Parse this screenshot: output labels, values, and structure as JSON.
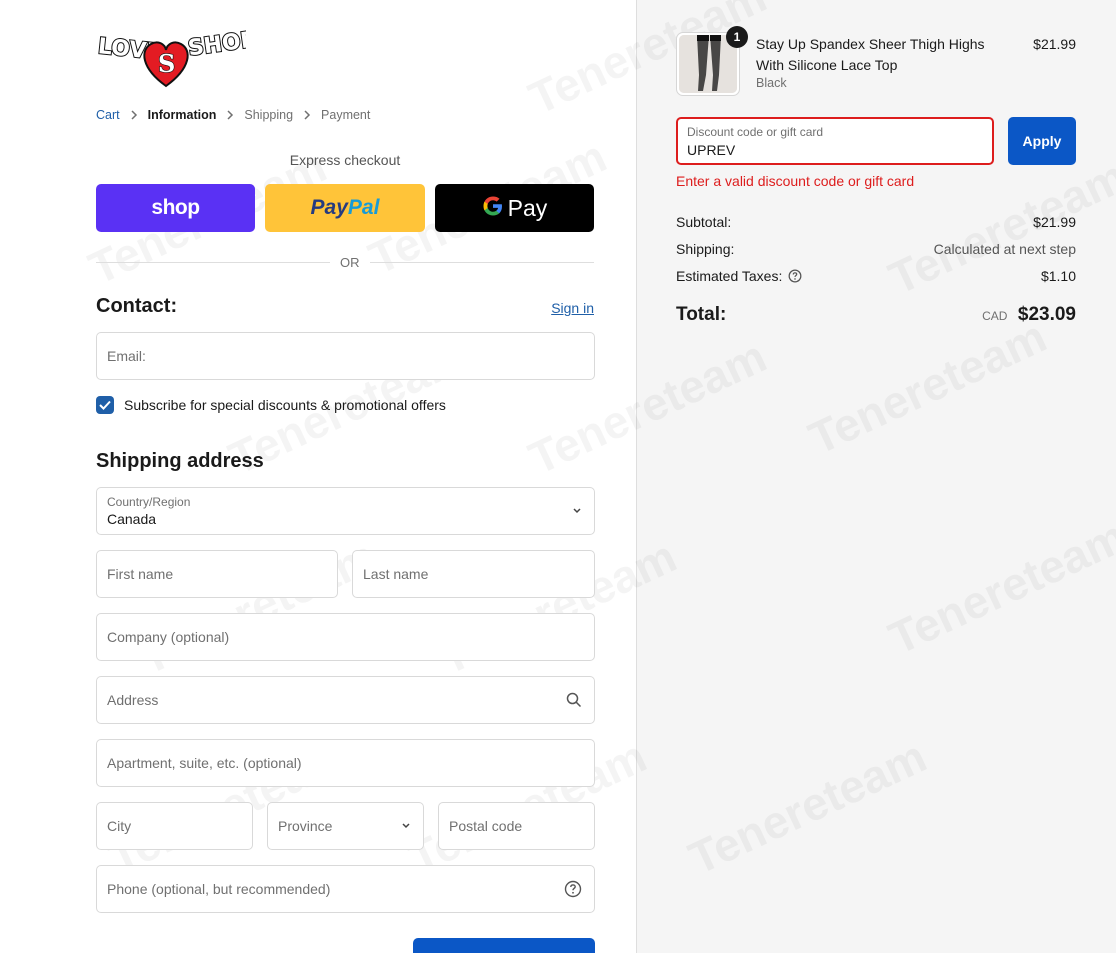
{
  "brand": {
    "logo_text_left": "LOVE",
    "logo_text_mid": "S",
    "logo_text_right": "SHOP"
  },
  "breadcrumb": [
    {
      "label": "Cart"
    },
    {
      "label": "Information"
    },
    {
      "label": "Shipping"
    },
    {
      "label": "Payment"
    }
  ],
  "express": {
    "title": "Express checkout",
    "shop_label": "shop",
    "paypal_part1": "Pay",
    "paypal_part2": "Pal",
    "gpay_label": "Pay",
    "or_label": "OR"
  },
  "contact": {
    "title": "Contact:",
    "signin_label": "Sign in",
    "email_placeholder": "Email:",
    "subscribe_label": "Subscribe for special discounts & promotional offers",
    "subscribe_checked": true
  },
  "shipping": {
    "title": "Shipping address",
    "country_label": "Country/Region",
    "country_value": "Canada",
    "first_name_placeholder": "First name",
    "last_name_placeholder": "Last name",
    "company_placeholder": "Company (optional)",
    "address_placeholder": "Address",
    "apartment_placeholder": "Apartment, suite, etc. (optional)",
    "city_placeholder": "City",
    "province_value": "Province",
    "postal_placeholder": "Postal code",
    "phone_placeholder": "Phone (optional, but recommended)"
  },
  "cart": {
    "item": {
      "name": "Stay Up Spandex Sheer Thigh Highs With Silicone Lace Top",
      "variant": "Black",
      "price": "$21.99",
      "quantity": "1"
    },
    "discount": {
      "label": "Discount code or gift card",
      "value": "UPREV",
      "apply_label": "Apply",
      "error": "Enter a valid discount code or gift card"
    },
    "summary": {
      "subtotal_label": "Subtotal:",
      "subtotal_value": "$21.99",
      "shipping_label": "Shipping:",
      "shipping_value": "Calculated at next step",
      "taxes_label": "Estimated Taxes:",
      "taxes_value": "$1.10",
      "total_label": "Total:",
      "total_currency": "CAD",
      "total_value": "$23.09"
    }
  },
  "colors": {
    "accent": "#0b57c6",
    "link": "#1f5fa8",
    "error": "#dd1d1d",
    "shop_pay": "#5a31f4",
    "paypal": "#ffc439"
  },
  "watermark": "Tenereteam"
}
